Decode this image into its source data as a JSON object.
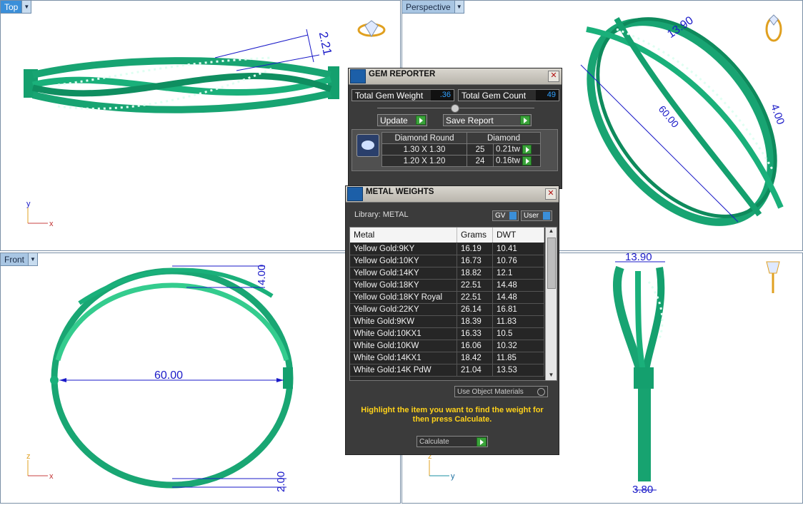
{
  "viewports": {
    "top": {
      "label": "Top"
    },
    "perspective": {
      "label": "Perspective"
    },
    "front": {
      "label": "Front"
    }
  },
  "dimensions": {
    "top_height": "2.21",
    "persp_width": "13.90",
    "persp_diameter": "60.00",
    "persp_side": "4.00",
    "front_top": "4.00",
    "front_diameter": "60.00",
    "front_bottom": "2.00",
    "right_width": "13.90",
    "right_bottom": "3.80"
  },
  "axes": {
    "x": "x",
    "y": "y",
    "z": "z"
  },
  "gem_reporter": {
    "title": "GEM REPORTER",
    "total_gem_weight_label": "Total Gem Weight",
    "total_gem_weight_value": ".36",
    "total_gem_count_label": "Total Gem Count",
    "total_gem_count_value": "49",
    "update_label": "Update",
    "save_report_label": "Save Report",
    "table": {
      "headers": [
        "Diamond Round",
        "Diamond"
      ],
      "rows": [
        {
          "size": "1.30 X 1.30",
          "count": "25",
          "weight": "0.21tw"
        },
        {
          "size": "1.20 X 1.20",
          "count": "24",
          "weight": "0.16tw"
        }
      ]
    }
  },
  "metal_weights": {
    "title": "METAL WEIGHTS",
    "library_label": "Library: METAL",
    "gv_label": "GV",
    "user_label": "User",
    "headers": [
      "Metal",
      "Grams",
      "DWT"
    ],
    "rows": [
      {
        "metal": "Yellow Gold:9KY",
        "grams": "16.19",
        "dwt": "10.41"
      },
      {
        "metal": "Yellow Gold:10KY",
        "grams": "16.73",
        "dwt": "10.76"
      },
      {
        "metal": "Yellow Gold:14KY",
        "grams": "18.82",
        "dwt": "12.1"
      },
      {
        "metal": "Yellow Gold:18KY",
        "grams": "22.51",
        "dwt": "14.48"
      },
      {
        "metal": "Yellow Gold:18KY Royal",
        "grams": "22.51",
        "dwt": "14.48"
      },
      {
        "metal": "Yellow Gold:22KY",
        "grams": "26.14",
        "dwt": "16.81"
      },
      {
        "metal": "White Gold:9KW",
        "grams": "18.39",
        "dwt": "11.83"
      },
      {
        "metal": "White Gold:10KX1",
        "grams": "16.33",
        "dwt": "10.5"
      },
      {
        "metal": "White Gold:10KW",
        "grams": "16.06",
        "dwt": "10.32"
      },
      {
        "metal": "White Gold:14KX1",
        "grams": "18.42",
        "dwt": "11.85"
      },
      {
        "metal": "White Gold:14K PdW",
        "grams": "21.04",
        "dwt": "13.53"
      }
    ],
    "use_object_materials_label": "Use Object Materials",
    "hint": "Highlight the item you want to find the weight for then press Calculate.",
    "calculate_label": "Calculate"
  },
  "colors": {
    "model": "#1aa876",
    "dim": "#1a1ac8",
    "accent": "#3b8fd9",
    "hint": "#ffd21a"
  }
}
